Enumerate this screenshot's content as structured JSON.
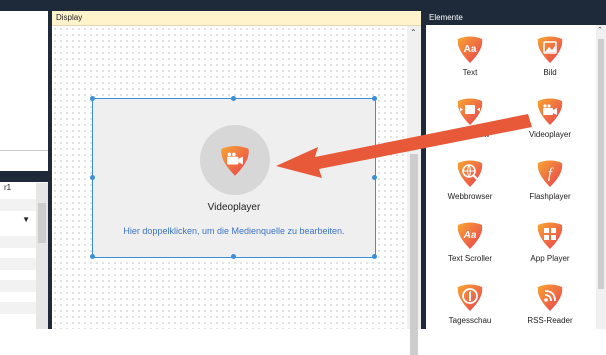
{
  "display": {
    "title": "Display"
  },
  "elements": {
    "title": "Elemente",
    "items": [
      {
        "label": "Text",
        "icon": "text-icon",
        "glyph": "Aa"
      },
      {
        "label": "Bild",
        "icon": "image-icon",
        "glyph": "▣"
      },
      {
        "label": "Bildershow",
        "icon": "slideshow-icon",
        "glyph": "◂▣▸"
      },
      {
        "label": "Videoplayer",
        "icon": "video-camera-icon",
        "glyph": "■"
      },
      {
        "label": "Webbrowser",
        "icon": "web-search-icon",
        "glyph": "◍"
      },
      {
        "label": "Flashplayer",
        "icon": "flash-icon",
        "glyph": "ƒ"
      },
      {
        "label": "Text Scroller",
        "icon": "text-scroller-icon",
        "glyph": "Aa"
      },
      {
        "label": "App Player",
        "icon": "app-grid-icon",
        "glyph": "⊞"
      },
      {
        "label": "Tagesschau",
        "icon": "tagesschau-icon",
        "glyph": "①"
      },
      {
        "label": "RSS-Reader",
        "icon": "rss-icon",
        "glyph": "◔"
      }
    ]
  },
  "widget": {
    "title": "Videoplayer",
    "hint": "Hier doppelklicken, um die Medienquelle zu bearbeiten."
  },
  "left_panel": {
    "field_value": "r1"
  },
  "colors": {
    "dark_bar": "#1e2a3a",
    "display_header": "#fff3cc",
    "selection": "#3a8fd8",
    "icon_gradient_start": "#f7a531",
    "icon_gradient_end": "#e83e52",
    "arrow": "#e8593a"
  }
}
